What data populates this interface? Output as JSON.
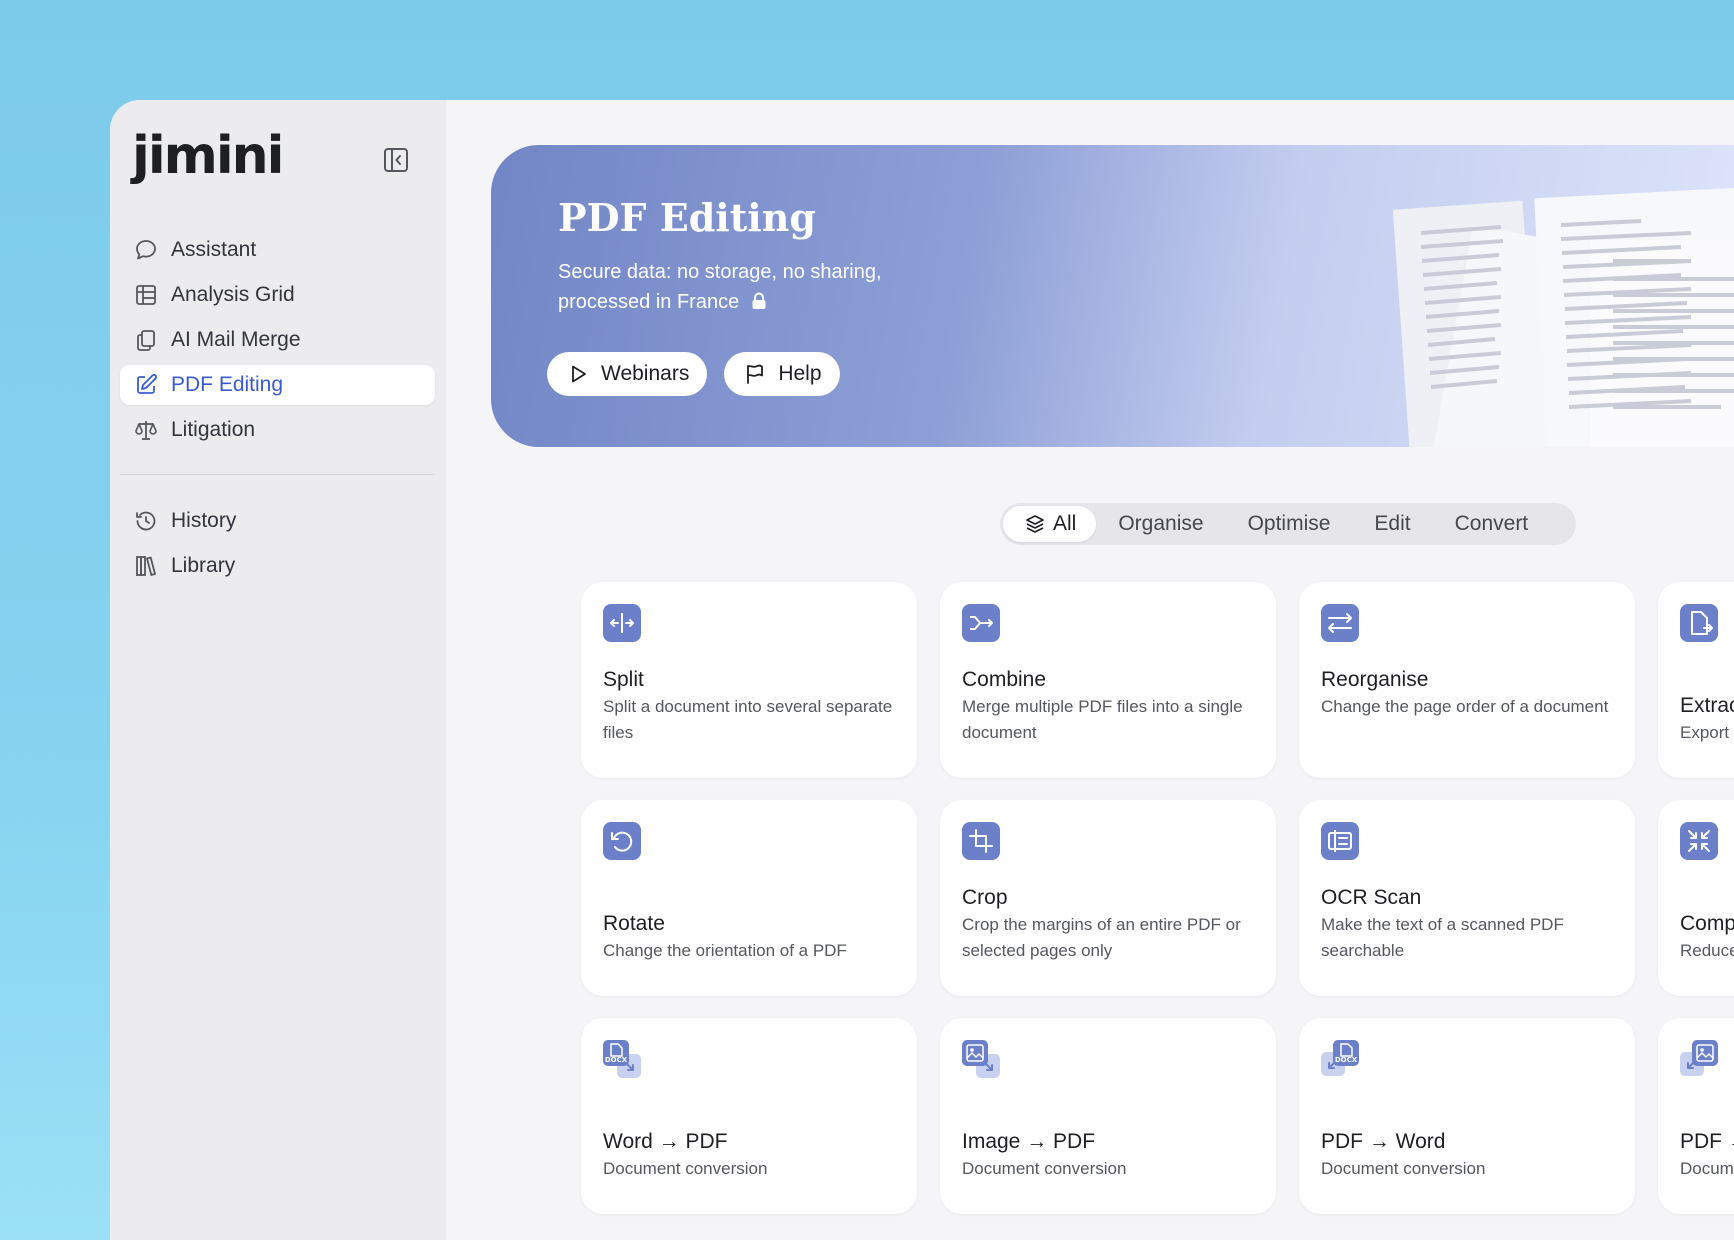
{
  "app": {
    "logo": "jimini"
  },
  "sidebar": {
    "items": [
      {
        "label": "Assistant",
        "icon": "chat-bubble-icon"
      },
      {
        "label": "Analysis Grid",
        "icon": "grid-icon"
      },
      {
        "label": "AI Mail Merge",
        "icon": "copy-docs-icon"
      },
      {
        "label": "PDF Editing",
        "icon": "edit-pencil-icon",
        "active": true
      },
      {
        "label": "Litigation",
        "icon": "scales-icon"
      }
    ],
    "secondary": [
      {
        "label": "History",
        "icon": "history-icon"
      },
      {
        "label": "Library",
        "icon": "library-icon"
      }
    ],
    "active_color": "#3a5bd0"
  },
  "hero": {
    "title": "PDF Editing",
    "subtitle": "Secure data: no storage, no sharing, processed in France",
    "buttons": {
      "webinars": "Webinars",
      "help": "Help"
    }
  },
  "filters": {
    "all": "All",
    "organise": "Organise",
    "optimise": "Optimise",
    "edit": "Edit",
    "convert": "Convert"
  },
  "tools": {
    "split": {
      "title": "Split",
      "desc": "Split a document into several separate files"
    },
    "combine": {
      "title": "Combine",
      "desc": "Merge multiple PDF files into a single document"
    },
    "reorganise": {
      "title": "Reorganise",
      "desc": "Change the page order of a document"
    },
    "extract": {
      "title": "Extrac",
      "desc": "Export"
    },
    "rotate": {
      "title": "Rotate",
      "desc": "Change the orientation of a PDF"
    },
    "crop": {
      "title": "Crop",
      "desc": "Crop the margins of an entire PDF or selected pages only"
    },
    "ocr": {
      "title": "OCR Scan",
      "desc": "Make the text of a scanned PDF searchable"
    },
    "compress": {
      "title": "Comp",
      "desc": "Reduce"
    },
    "word_pdf": {
      "title": "Word → PDF",
      "desc": "Document conversion",
      "badge": "DOCX"
    },
    "image_pdf": {
      "title": "Image → PDF",
      "desc": "Document conversion"
    },
    "pdf_word": {
      "title": "PDF → Word",
      "desc": "Document conversion",
      "badge": "DOCX"
    },
    "pdf_image": {
      "title": "PDF →",
      "desc": "Docum"
    }
  },
  "colors": {
    "icon_bg": "#6b80c9",
    "icon_light": "#c8d1f0"
  }
}
